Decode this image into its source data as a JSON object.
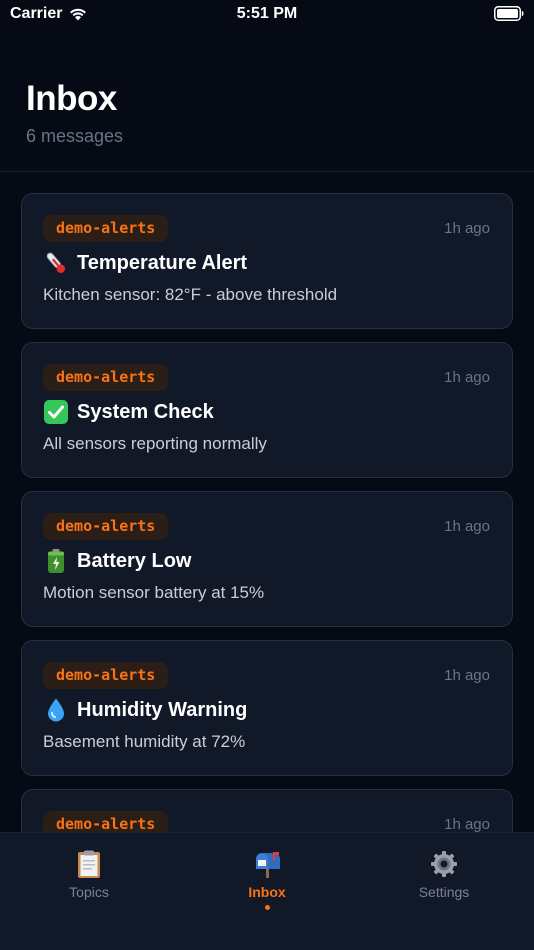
{
  "status_bar": {
    "carrier": "Carrier",
    "time": "5:51 PM"
  },
  "header": {
    "title": "Inbox",
    "subtitle": "6 messages"
  },
  "messages": [
    {
      "topic": "demo-alerts",
      "time": "1h ago",
      "icon": "thermometer-icon",
      "title": "Temperature Alert",
      "body": "Kitchen sensor: 82°F - above threshold"
    },
    {
      "topic": "demo-alerts",
      "time": "1h ago",
      "icon": "check-mark-icon",
      "title": "System Check",
      "body": "All sensors reporting normally"
    },
    {
      "topic": "demo-alerts",
      "time": "1h ago",
      "icon": "battery-icon",
      "title": "Battery Low",
      "body": "Motion sensor battery at 15%"
    },
    {
      "topic": "demo-alerts",
      "time": "1h ago",
      "icon": "droplet-icon",
      "title": "Humidity Warning",
      "body": "Basement humidity at 72%"
    },
    {
      "topic": "demo-alerts",
      "time": "1h ago",
      "icon": "",
      "title": "",
      "body": ""
    }
  ],
  "tab_bar": {
    "items": [
      {
        "label": "Topics",
        "icon": "clipboard-icon"
      },
      {
        "label": "Inbox",
        "icon": "mailbox-icon",
        "active": true
      },
      {
        "label": "Settings",
        "icon": "gear-icon"
      }
    ]
  },
  "colors": {
    "accent": "#f97316",
    "background": "#050a14",
    "card": "#111827"
  }
}
